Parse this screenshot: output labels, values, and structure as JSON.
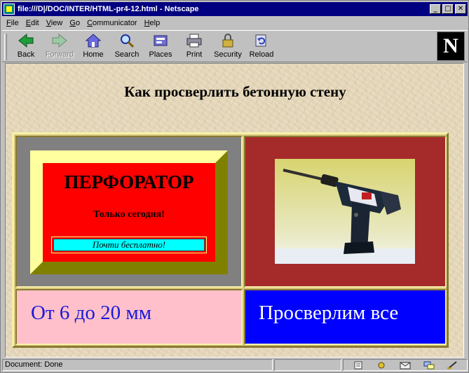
{
  "window": {
    "title": "file:///D|/DOC/INTER/HTML-pr4-12.html - Netscape",
    "buttons": {
      "minimize": "_",
      "maximize": "□",
      "close": "✕"
    }
  },
  "menubar": {
    "items": [
      {
        "label": "File",
        "accel": "F"
      },
      {
        "label": "Edit",
        "accel": "E"
      },
      {
        "label": "View",
        "accel": "V"
      },
      {
        "label": "Go",
        "accel": "G"
      },
      {
        "label": "Communicator",
        "accel": "C"
      },
      {
        "label": "Help",
        "accel": "H"
      }
    ]
  },
  "toolbar": {
    "buttons": [
      {
        "label": "Back",
        "icon": "back-arrow-icon",
        "enabled": true
      },
      {
        "label": "Forward",
        "icon": "forward-arrow-icon",
        "enabled": false
      },
      {
        "label": "Home",
        "icon": "home-icon",
        "enabled": true
      },
      {
        "label": "Search",
        "icon": "search-icon",
        "enabled": true
      },
      {
        "label": "Places",
        "icon": "places-icon",
        "enabled": true
      },
      {
        "label": "Print",
        "icon": "print-icon",
        "enabled": true
      },
      {
        "label": "Security",
        "icon": "security-lock-icon",
        "enabled": true
      },
      {
        "label": "Reload",
        "icon": "reload-icon",
        "enabled": true
      }
    ],
    "logo_letter": "N"
  },
  "page": {
    "heading": "Как просверлить бетонную стену",
    "ad": {
      "title": "ПЕРФОРАТОР",
      "subtitle": "Только сегодня!",
      "badge": "Почти бесплатно!"
    },
    "size_text": "От 6 до 20 мм",
    "drill_text": "Просверлим все",
    "colors": {
      "background": "#e4d6b8",
      "ad_cell": "#808080",
      "ad_frame": "#808000",
      "ad_panel": "#ff0000",
      "badge": "#00ffff",
      "image_cell": "#a52a2a",
      "size_cell": "#ffc0cb",
      "drill_cell": "#0000ff"
    }
  },
  "statusbar": {
    "text": "Document: Done"
  }
}
